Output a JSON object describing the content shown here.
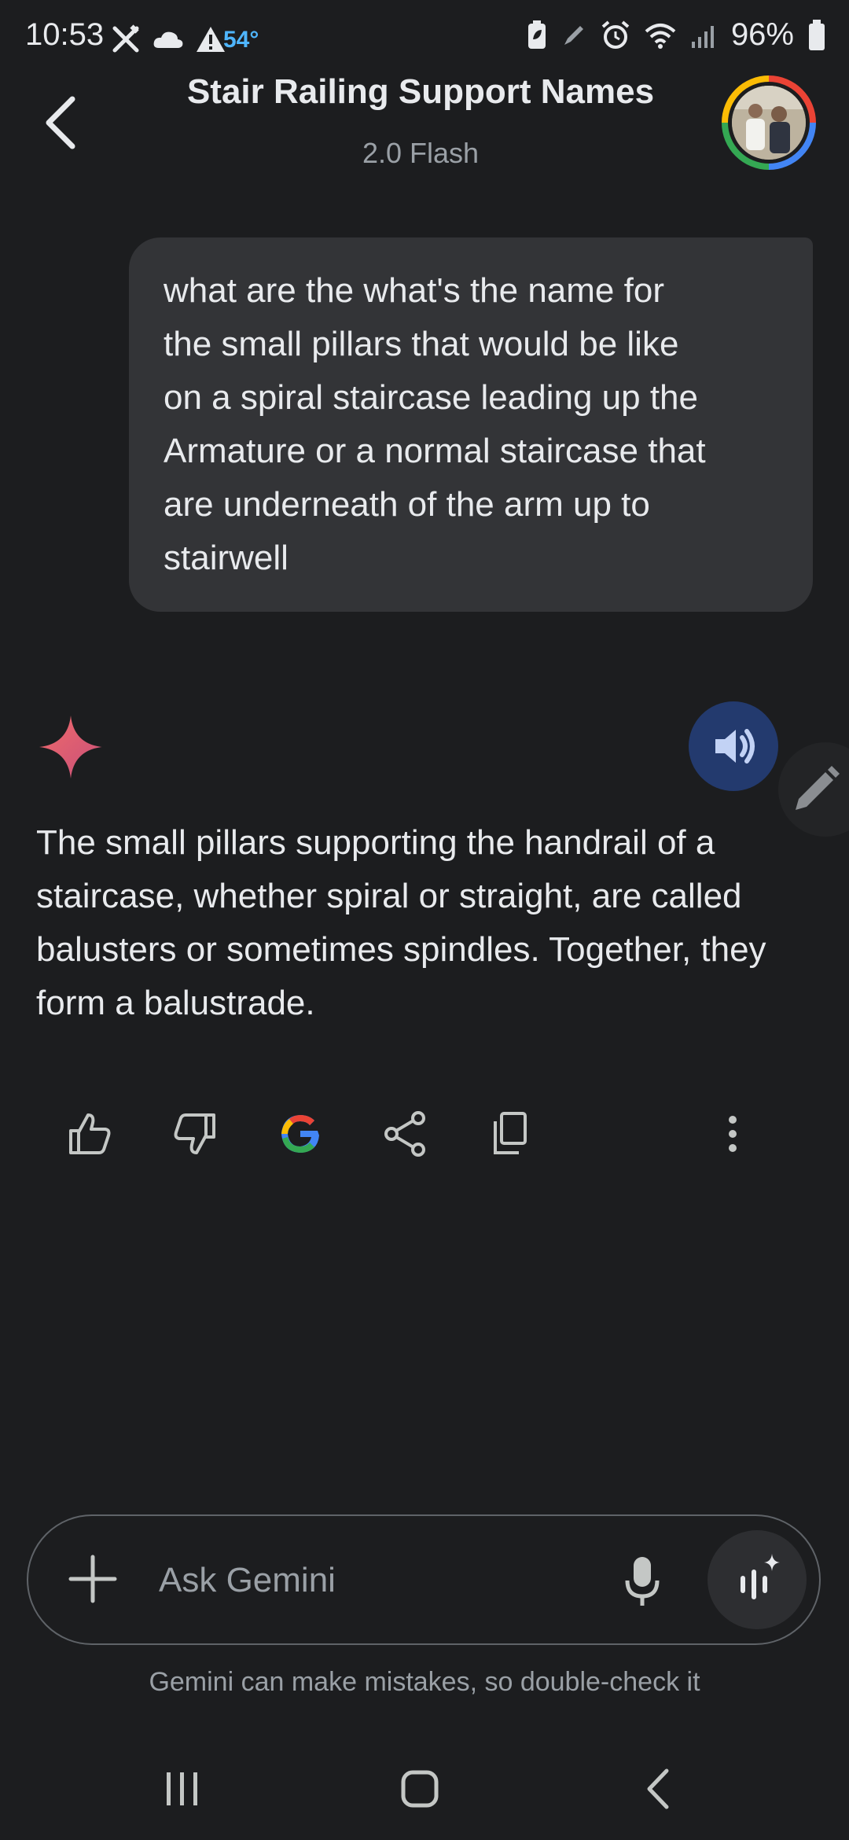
{
  "status_bar": {
    "time": "10:53",
    "temperature": "54°",
    "battery_percent": "96%"
  },
  "header": {
    "back_icon": "chevron-left-icon",
    "title": "Stair Railing Support Names",
    "subtitle": "2.0 Flash"
  },
  "conversation": {
    "user_message": "what are the what's the name for\nthe small pillars that would be like\non a spiral staircase leading up the\nArmature or a normal staircase that\nare underneath of the arm up to\nstairwell",
    "response_text": "The small pillars supporting the handrail of a staircase, whether spiral or straight, are called balusters or sometimes spindles. Together, they form a balustrade."
  },
  "actions": [
    "thumb-up-icon",
    "thumb-down-icon",
    "google-icon",
    "share-icon",
    "copy-icon",
    "more-vert-icon"
  ],
  "input": {
    "placeholder": "Ask Gemini"
  },
  "disclaimer": "Gemini can make mistakes, so double-check it",
  "colors": {
    "background": "#1c1d1f",
    "bubble": "#333437",
    "speaker_button": "#233a6e",
    "accent_temp": "#4fb6ff"
  }
}
